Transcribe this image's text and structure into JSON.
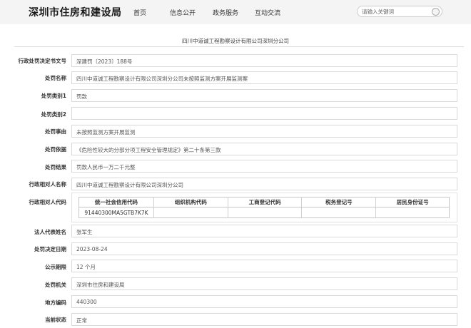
{
  "header": {
    "site_title": "深圳市住房和建设局",
    "nav": [
      "首页",
      "信息公开",
      "政务服务",
      "互动交流"
    ],
    "search_placeholder": "请输入关键词"
  },
  "document": {
    "title": "四川中道诚工程勘察设计有限公司深圳分公司"
  },
  "fields": [
    {
      "label": "行政处罚决定书文号",
      "value": "深建罚〔2023〕188号"
    },
    {
      "label": "处罚名称",
      "value": "四川中道诚工程勘察设计有限公司深圳分公司未按照监测方案开展监测案"
    },
    {
      "label": "处罚类别1",
      "value": "罚款"
    },
    {
      "label": "处罚类别2",
      "value": ""
    },
    {
      "label": "处罚事由",
      "value": "未按照监测方案开展监测"
    },
    {
      "label": "处罚依据",
      "value": "《危险性较大的分部分项工程安全管理规定》第二十条第三款"
    },
    {
      "label": "处罚结果",
      "value": "罚款人民币一万二千元整"
    },
    {
      "label": "行政相对人名称",
      "value": "四川中道诚工程勘察设计有限公司深圳分公司"
    }
  ],
  "party_codes": {
    "label": "行政相对人代码",
    "headers": [
      "统一社会信用代码",
      "组织机构代码",
      "工商登记代码",
      "税务登记号",
      "居民身份证号"
    ],
    "values": [
      "91440300MA5GTB7K7K",
      "",
      "",
      "",
      ""
    ]
  },
  "fields_bottom": [
    {
      "label": "法人代表姓名",
      "value": "张军生"
    },
    {
      "label": "处罚决定日期",
      "value": "2023-08-24"
    },
    {
      "label": "公示期限",
      "value": "12 个月"
    },
    {
      "label": "处罚机关",
      "value": "深圳市住房和建设局"
    },
    {
      "label": "地方编码",
      "value": "440300"
    },
    {
      "label": "当前状态",
      "value": "正常"
    }
  ]
}
